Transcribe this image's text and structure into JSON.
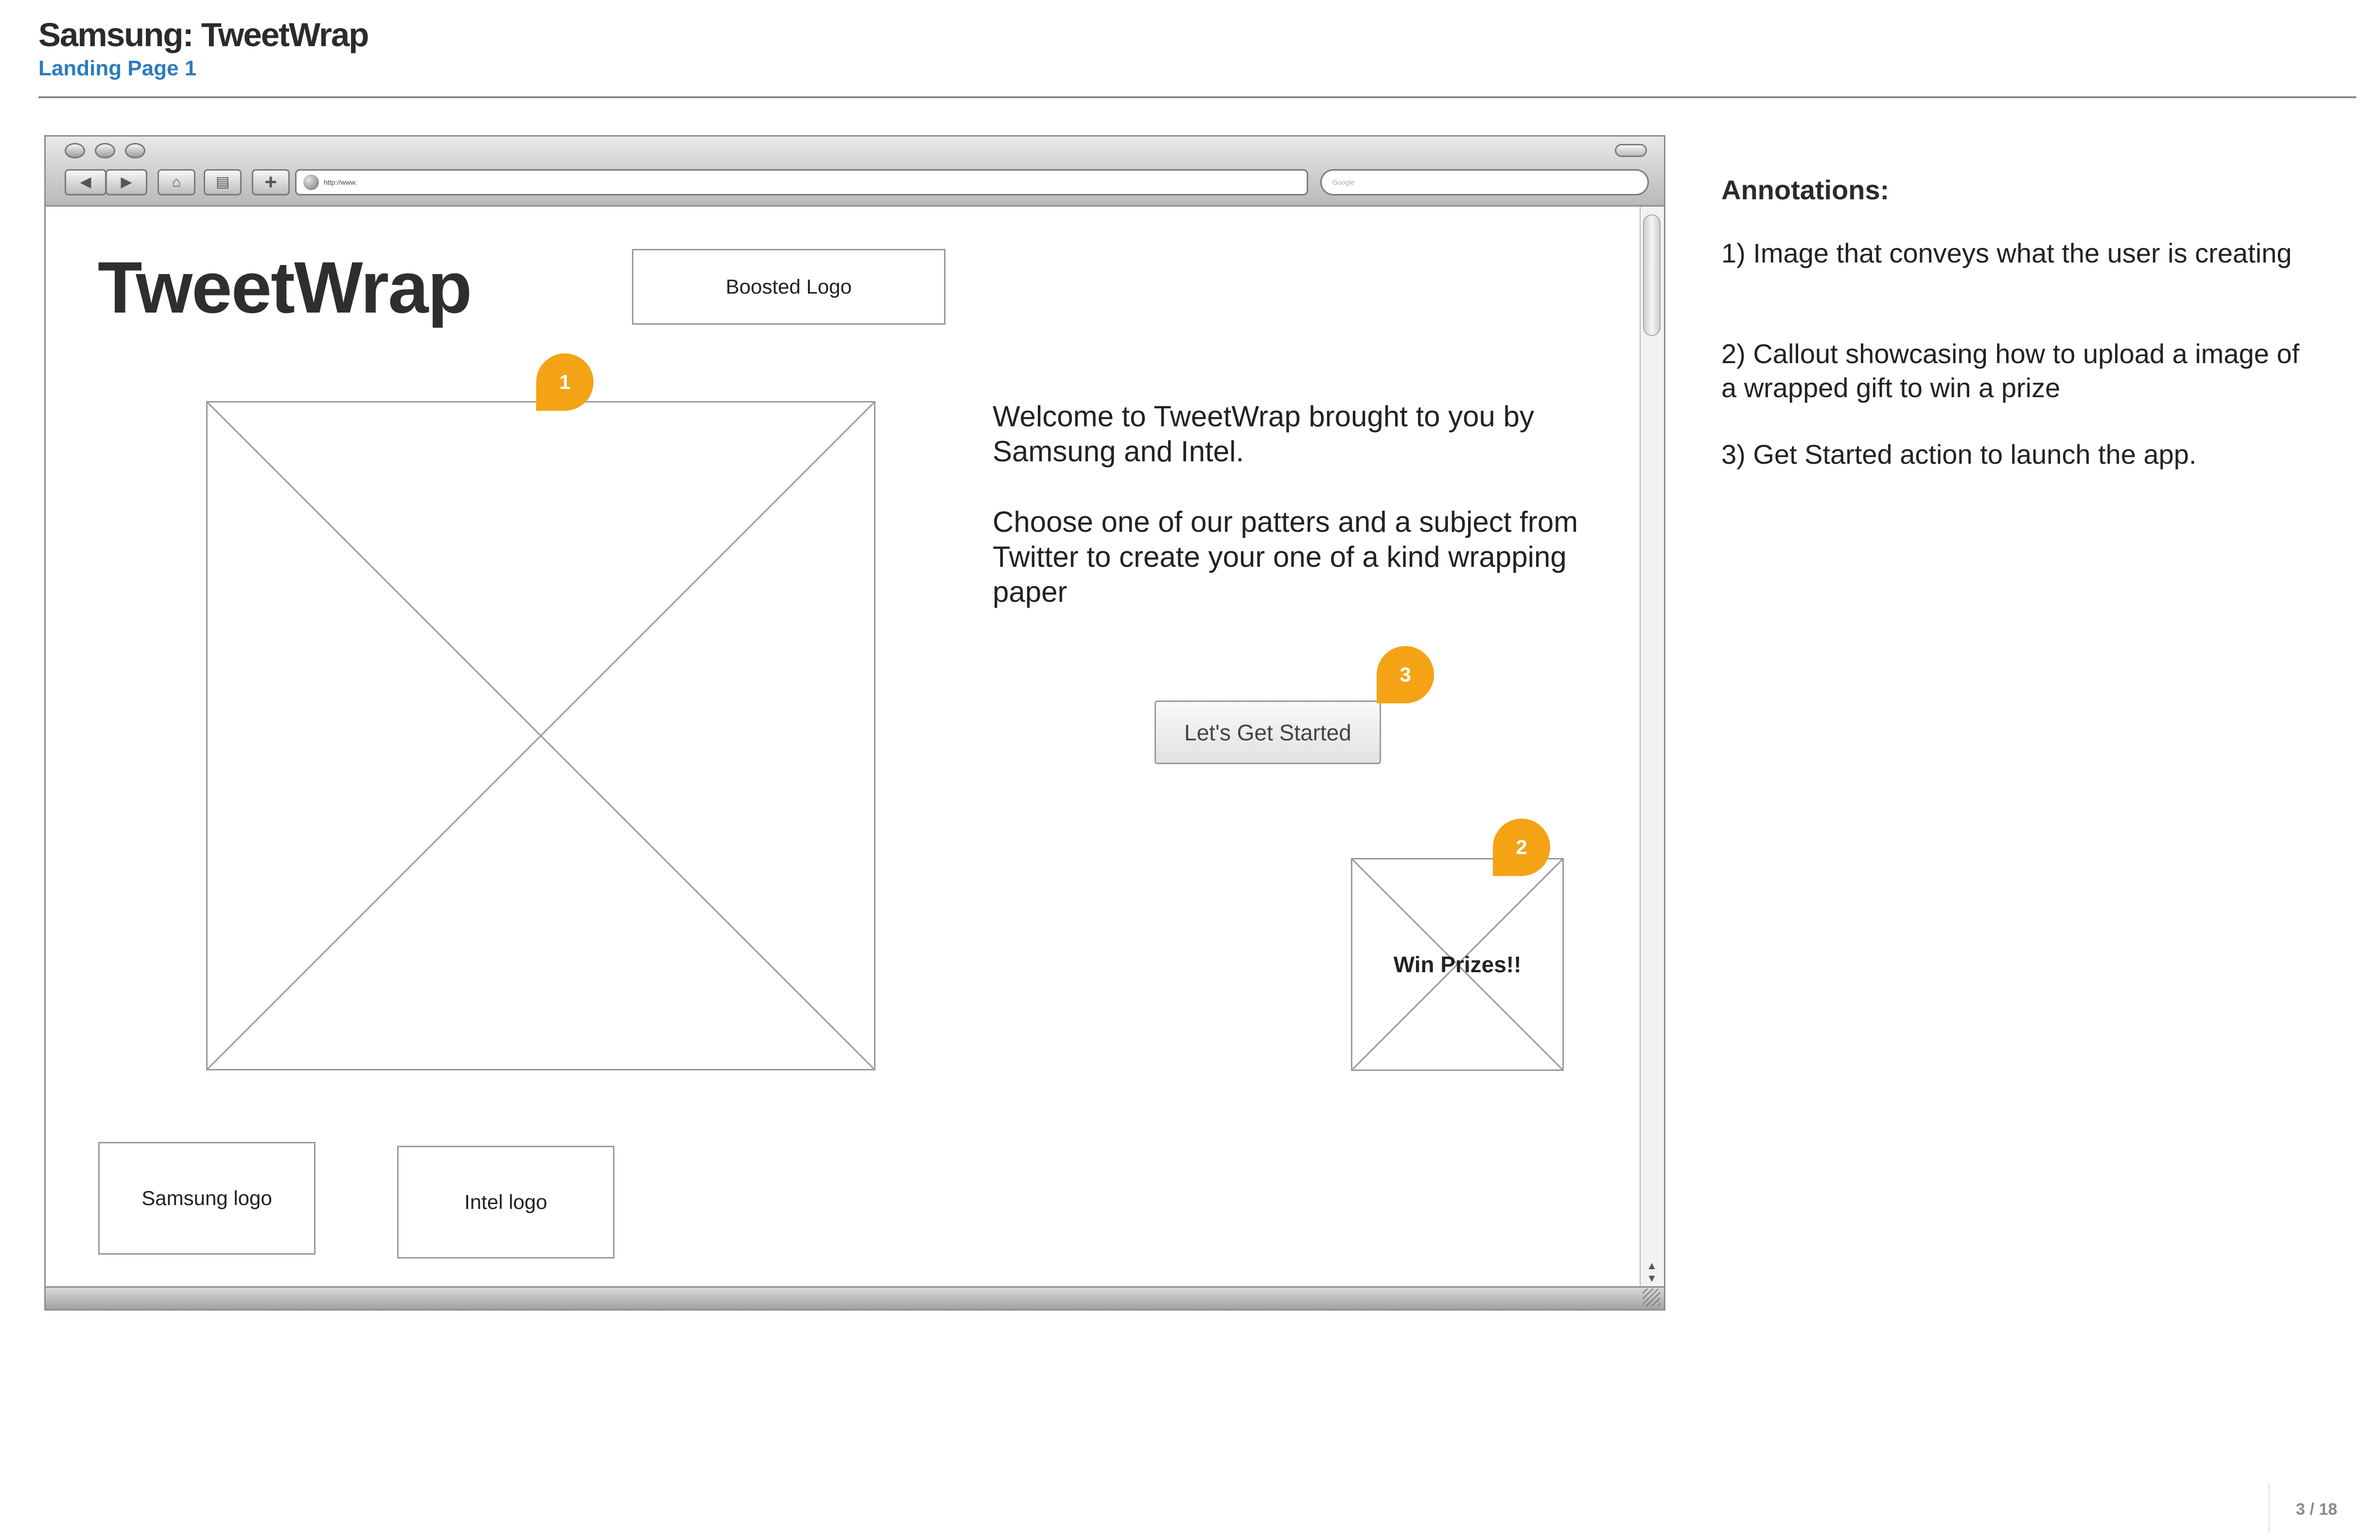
{
  "header": {
    "title": "Samsung: TweetWrap",
    "subtitle": "Landing Page 1"
  },
  "browser": {
    "url_text": "http://www.",
    "search_placeholder": "Google",
    "icons": [
      "back-arrow-icon",
      "forward-arrow-icon",
      "home-icon",
      "print-icon",
      "plus-icon",
      "globe-icon"
    ]
  },
  "page": {
    "title": "TweetWrap",
    "boosted_logo": "Boosted Logo",
    "welcome_text": "Welcome to TweetWrap brought to you by Samsung and Intel.",
    "choose_text": "Choose one of our patters and a subject from Twitter to create your one of a kind wrapping paper",
    "cta_label": "Let's Get Started",
    "prize_label": "Win Prizes!!",
    "samsung_logo": "Samsung logo",
    "intel_logo": "Intel logo"
  },
  "callouts": {
    "one": "1",
    "two": "2",
    "three": "3",
    "color": "#f4a315"
  },
  "annotations": {
    "heading": "Annotations:",
    "items": [
      "1) Image that conveys what the user is creating",
      "2) Callout showcasing how to upload a image of a wrapped gift to win a prize",
      "3) Get Started action to launch the app."
    ]
  },
  "footer": {
    "page_number": "3 / 18"
  },
  "colors": {
    "accent": "#2c7bbf",
    "callout": "#f4a315"
  }
}
